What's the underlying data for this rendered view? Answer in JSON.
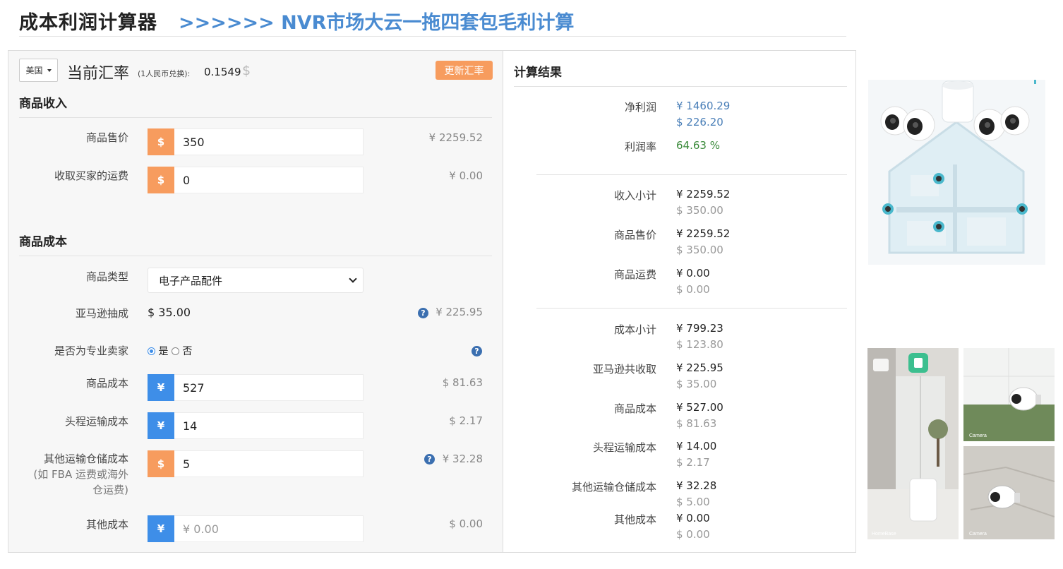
{
  "header": {
    "title": "成本利润计算器",
    "subtitle": ">>>>>> NVR市场大云一拖四套包毛利计算"
  },
  "rate": {
    "country": "美国",
    "title": "当前汇率",
    "note": "(1人民币兑换):",
    "value": "0.1549",
    "currency_symbol": "$",
    "update_label": "更新汇率"
  },
  "income": {
    "section_title": "商品收入",
    "price": {
      "label": "商品售价",
      "addon": "$",
      "value": "350",
      "converted": "¥ 2259.52"
    },
    "shipping": {
      "label": "收取买家的运费",
      "addon": "$",
      "value": "0",
      "converted": "¥ 0.00"
    }
  },
  "cost": {
    "section_title": "商品成本",
    "type": {
      "label": "商品类型",
      "selected": "电子产品配件"
    },
    "commission": {
      "label": "亚马逊抽成",
      "value": "$ 35.00",
      "converted": "¥ 225.95",
      "help": "?"
    },
    "pro_seller": {
      "label": "是否为专业卖家",
      "yes": "是",
      "no": "否",
      "help": "?"
    },
    "goods_cost": {
      "label": "商品成本",
      "addon": "¥",
      "value": "527",
      "converted": "$ 81.63"
    },
    "first_leg": {
      "label": "头程运输成本",
      "addon": "¥",
      "value": "14",
      "converted": "$ 2.17"
    },
    "other_shipping": {
      "label_l1": "其他运输仓储成本",
      "label_l2": "(如 FBA 运费或海外",
      "label_l3": "仓运费)",
      "addon": "$",
      "value": "5",
      "converted": "¥ 32.28",
      "help": "?"
    },
    "other_cost": {
      "label": "其他成本",
      "addon": "¥",
      "placeholder": "¥  0.00",
      "converted": "$ 0.00"
    }
  },
  "results": {
    "title": "计算结果",
    "net_profit": {
      "label": "净利润",
      "cny": "¥ 1460.29",
      "usd": "$ 226.20"
    },
    "margin": {
      "label": "利润率",
      "value": "64.63 %"
    },
    "income_subtotal": {
      "label": "收入小计",
      "cny": "¥ 2259.52",
      "usd": "$ 350.00"
    },
    "price": {
      "label": "商品售价",
      "cny": "¥ 2259.52",
      "usd": "$ 350.00"
    },
    "shipping": {
      "label": "商品运费",
      "cny": "¥ 0.00",
      "usd": "$ 0.00"
    },
    "cost_subtotal": {
      "label": "成本小计",
      "cny": "¥ 799.23",
      "usd": "$ 123.80"
    },
    "amazon_total": {
      "label": "亚马逊共收取",
      "cny": "¥ 225.95",
      "usd": "$ 35.00"
    },
    "goods_cost": {
      "label": "商品成本",
      "cny": "¥ 527.00",
      "usd": "$ 81.63"
    },
    "first_leg": {
      "label": "头程运输成本",
      "cny": "¥ 14.00",
      "usd": "$ 2.17"
    },
    "other_shipping": {
      "label": "其他运输仓储成本",
      "cny": "¥ 32.28",
      "usd": "$ 5.00"
    },
    "other_cost": {
      "label": "其他成本",
      "cny": "¥ 0.00",
      "usd": "$ 0.00"
    }
  },
  "images": {
    "homebase_caption": "HomeBase",
    "camera_caption_1": "Camera",
    "camera_caption_2": "Camera"
  }
}
